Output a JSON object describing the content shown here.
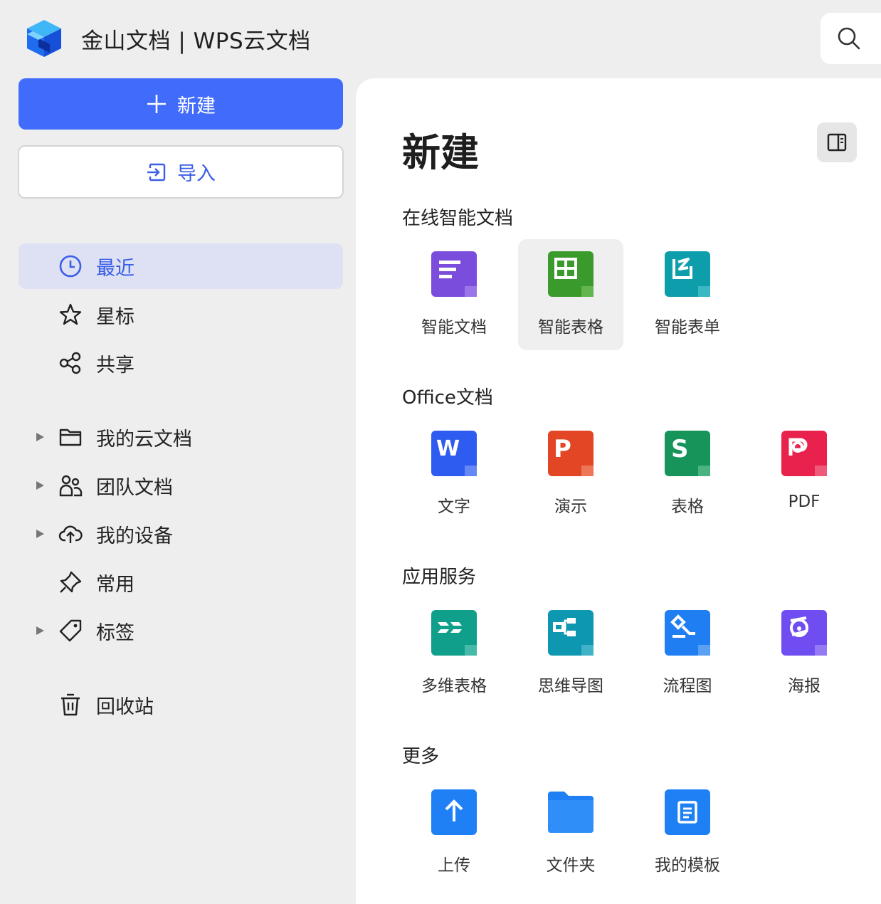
{
  "header": {
    "app_title": "金山文档 | WPS云文档",
    "logo_icon": "cube-logo-icon",
    "search_icon": "search-icon"
  },
  "sidebar": {
    "new_label": "新建",
    "import_label": "导入",
    "items": [
      {
        "label": "最近",
        "icon": "clock-icon",
        "active": true
      },
      {
        "label": "星标",
        "icon": "star-icon"
      },
      {
        "label": "共享",
        "icon": "share-icon"
      },
      {
        "label": "我的云文档",
        "icon": "folder-icon",
        "expandable": true
      },
      {
        "label": "团队文档",
        "icon": "team-icon",
        "expandable": true
      },
      {
        "label": "我的设备",
        "icon": "cloud-upload-icon",
        "expandable": true
      },
      {
        "label": "常用",
        "icon": "pin-icon"
      },
      {
        "label": "标签",
        "icon": "tag-icon",
        "expandable": true
      },
      {
        "label": "回收站",
        "icon": "trash-icon"
      }
    ]
  },
  "main": {
    "title": "新建",
    "sections": [
      {
        "title": "在线智能文档",
        "items": [
          {
            "label": "智能文档",
            "icon": "smart-doc-icon",
            "color": "#7b4ddc"
          },
          {
            "label": "智能表格",
            "icon": "smart-sheet-icon",
            "color": "#3b9a2c",
            "hovered": true
          },
          {
            "label": "智能表单",
            "icon": "smart-form-icon",
            "color": "#0e9dab"
          }
        ]
      },
      {
        "title": "Office文档",
        "items": [
          {
            "label": "文字",
            "icon": "word-icon",
            "color": "#2f5cf0"
          },
          {
            "label": "演示",
            "icon": "presentation-icon",
            "color": "#e24624"
          },
          {
            "label": "表格",
            "icon": "spreadsheet-icon",
            "color": "#16945a"
          },
          {
            "label": "PDF",
            "icon": "pdf-icon",
            "color": "#e8224c"
          }
        ]
      },
      {
        "title": "应用服务",
        "items": [
          {
            "label": "多维表格",
            "icon": "multi-table-icon",
            "color": "#0f9f8a"
          },
          {
            "label": "思维导图",
            "icon": "mindmap-icon",
            "color": "#0d97b0"
          },
          {
            "label": "流程图",
            "icon": "flowchart-icon",
            "color": "#1f7ef2"
          },
          {
            "label": "海报",
            "icon": "poster-icon",
            "color": "#6f4df0"
          }
        ]
      },
      {
        "title": "更多",
        "items": [
          {
            "label": "上传",
            "icon": "upload-icon",
            "color": "#1f80f5"
          },
          {
            "label": "文件夹",
            "icon": "folder-blue-icon",
            "color": "#1f80f5"
          },
          {
            "label": "我的模板",
            "icon": "template-icon",
            "color": "#1f80f5"
          }
        ]
      }
    ]
  }
}
